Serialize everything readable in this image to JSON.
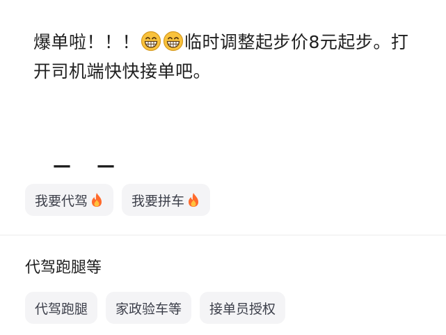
{
  "post": {
    "text_part1": "爆单啦！！！",
    "emoji_1": "grinning-face-emoji",
    "emoji_2": "grinning-face-emoji",
    "text_part2": "临时调整起步价8元起步。打开司机端快快接单吧。",
    "dashes": "— —"
  },
  "tags_top": [
    {
      "label": "我要代驾",
      "icon": "fire-icon"
    },
    {
      "label": "我要拼车",
      "icon": "fire-icon"
    }
  ],
  "section": {
    "title": "代驾跑腿等"
  },
  "tags_bottom": [
    {
      "label": "代驾跑腿"
    },
    {
      "label": "家政验车等"
    },
    {
      "label": "接单员授权"
    }
  ],
  "colors": {
    "chip_bg": "#f4f4f6",
    "chip_text": "#3c3f4a",
    "emoji_face": "#f9c23c",
    "fire": "#ff6a2b"
  }
}
